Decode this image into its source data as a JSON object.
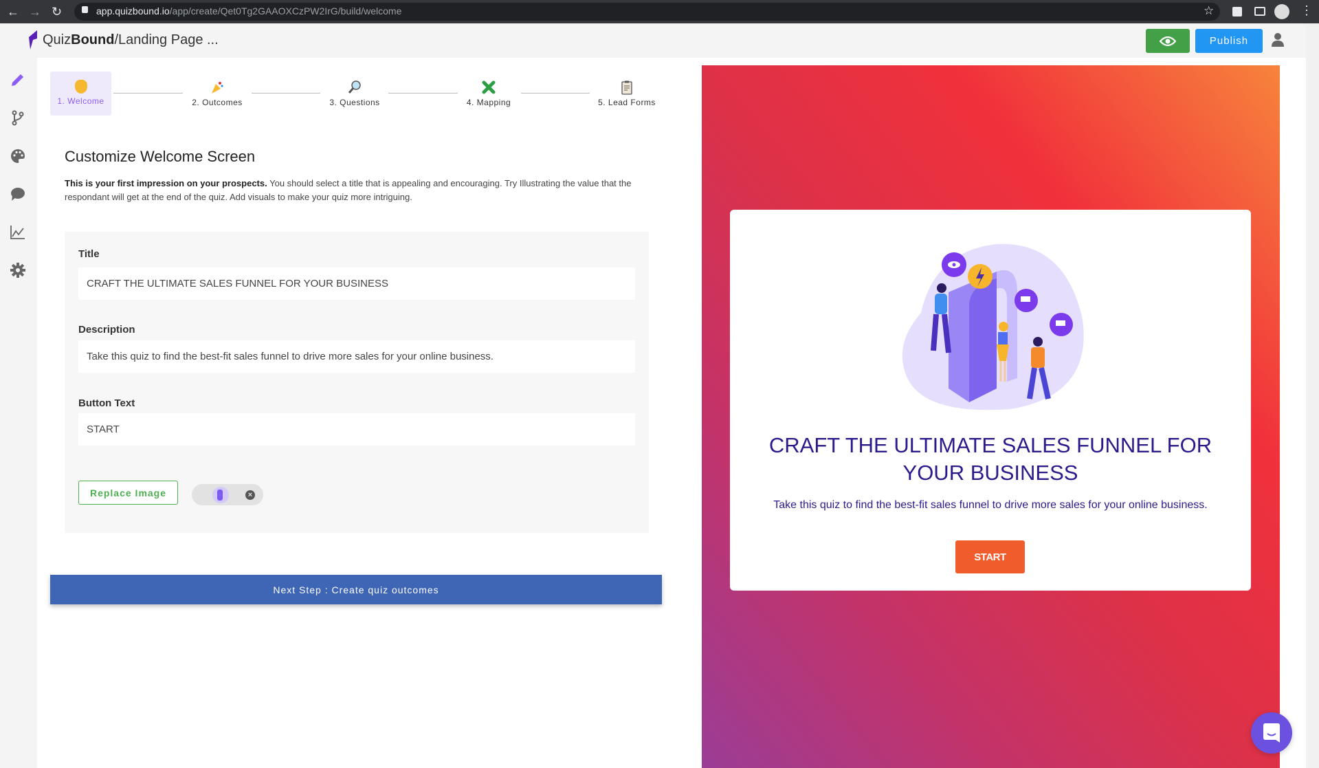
{
  "browser": {
    "url_host": "app.quizbound.io",
    "url_path": "/app/create/Qet0Tg2GAAOXCzPW2IrG/build/welcome"
  },
  "header": {
    "brand_light": "Quiz",
    "brand_bold": "Bound",
    "page_name": "/Landing Page ...",
    "publish_label": "Publish"
  },
  "sidebar": {
    "items": [
      {
        "icon": "pencil-icon"
      },
      {
        "icon": "branch-icon"
      },
      {
        "icon": "palette-icon"
      },
      {
        "icon": "chat-icon"
      },
      {
        "icon": "chart-icon"
      },
      {
        "icon": "gear-icon"
      }
    ]
  },
  "steps": [
    {
      "label": "1. Welcome",
      "icon": "clapping-hands-icon"
    },
    {
      "label": "2. Outcomes",
      "icon": "party-popper-icon"
    },
    {
      "label": "3. Questions",
      "icon": "magnifier-icon"
    },
    {
      "label": "4. Mapping",
      "icon": "puzzle-icon"
    },
    {
      "label": "5. Lead Forms",
      "icon": "clipboard-icon"
    }
  ],
  "main": {
    "heading": "Customize Welcome Screen",
    "intro_bold": "This is your first impression on your prospects.",
    "intro_rest": " You should select a title that is appealing and encouraging. Try Illustrating the value that the respondant will get at the end of the quiz. Add visuals to make your quiz more intriguing.",
    "fields": {
      "title_label": "Title",
      "title_value": "CRAFT THE ULTIMATE SALES FUNNEL FOR YOUR BUSINESS",
      "description_label": "Description",
      "description_value": "Take this quiz to find the best-fit sales funnel to drive more sales for your online business.",
      "button_label": "Button Text",
      "button_value": "START"
    },
    "replace_image_label": "Replace Image",
    "next_step_label": "Next Step : Create quiz outcomes"
  },
  "preview": {
    "title": "CRAFT THE ULTIMATE SALES FUNNEL FOR YOUR BUSINESS",
    "description": "Take this quiz to find the best-fit sales funnel to drive more sales for your online business.",
    "button": "START"
  },
  "colors": {
    "accent": "#8b5cf6",
    "publish": "#2196f3",
    "preview_green": "#43a047",
    "next_step": "#3f65b5",
    "start_button": "#f05c2c",
    "preview_title": "#2a1a8c"
  }
}
